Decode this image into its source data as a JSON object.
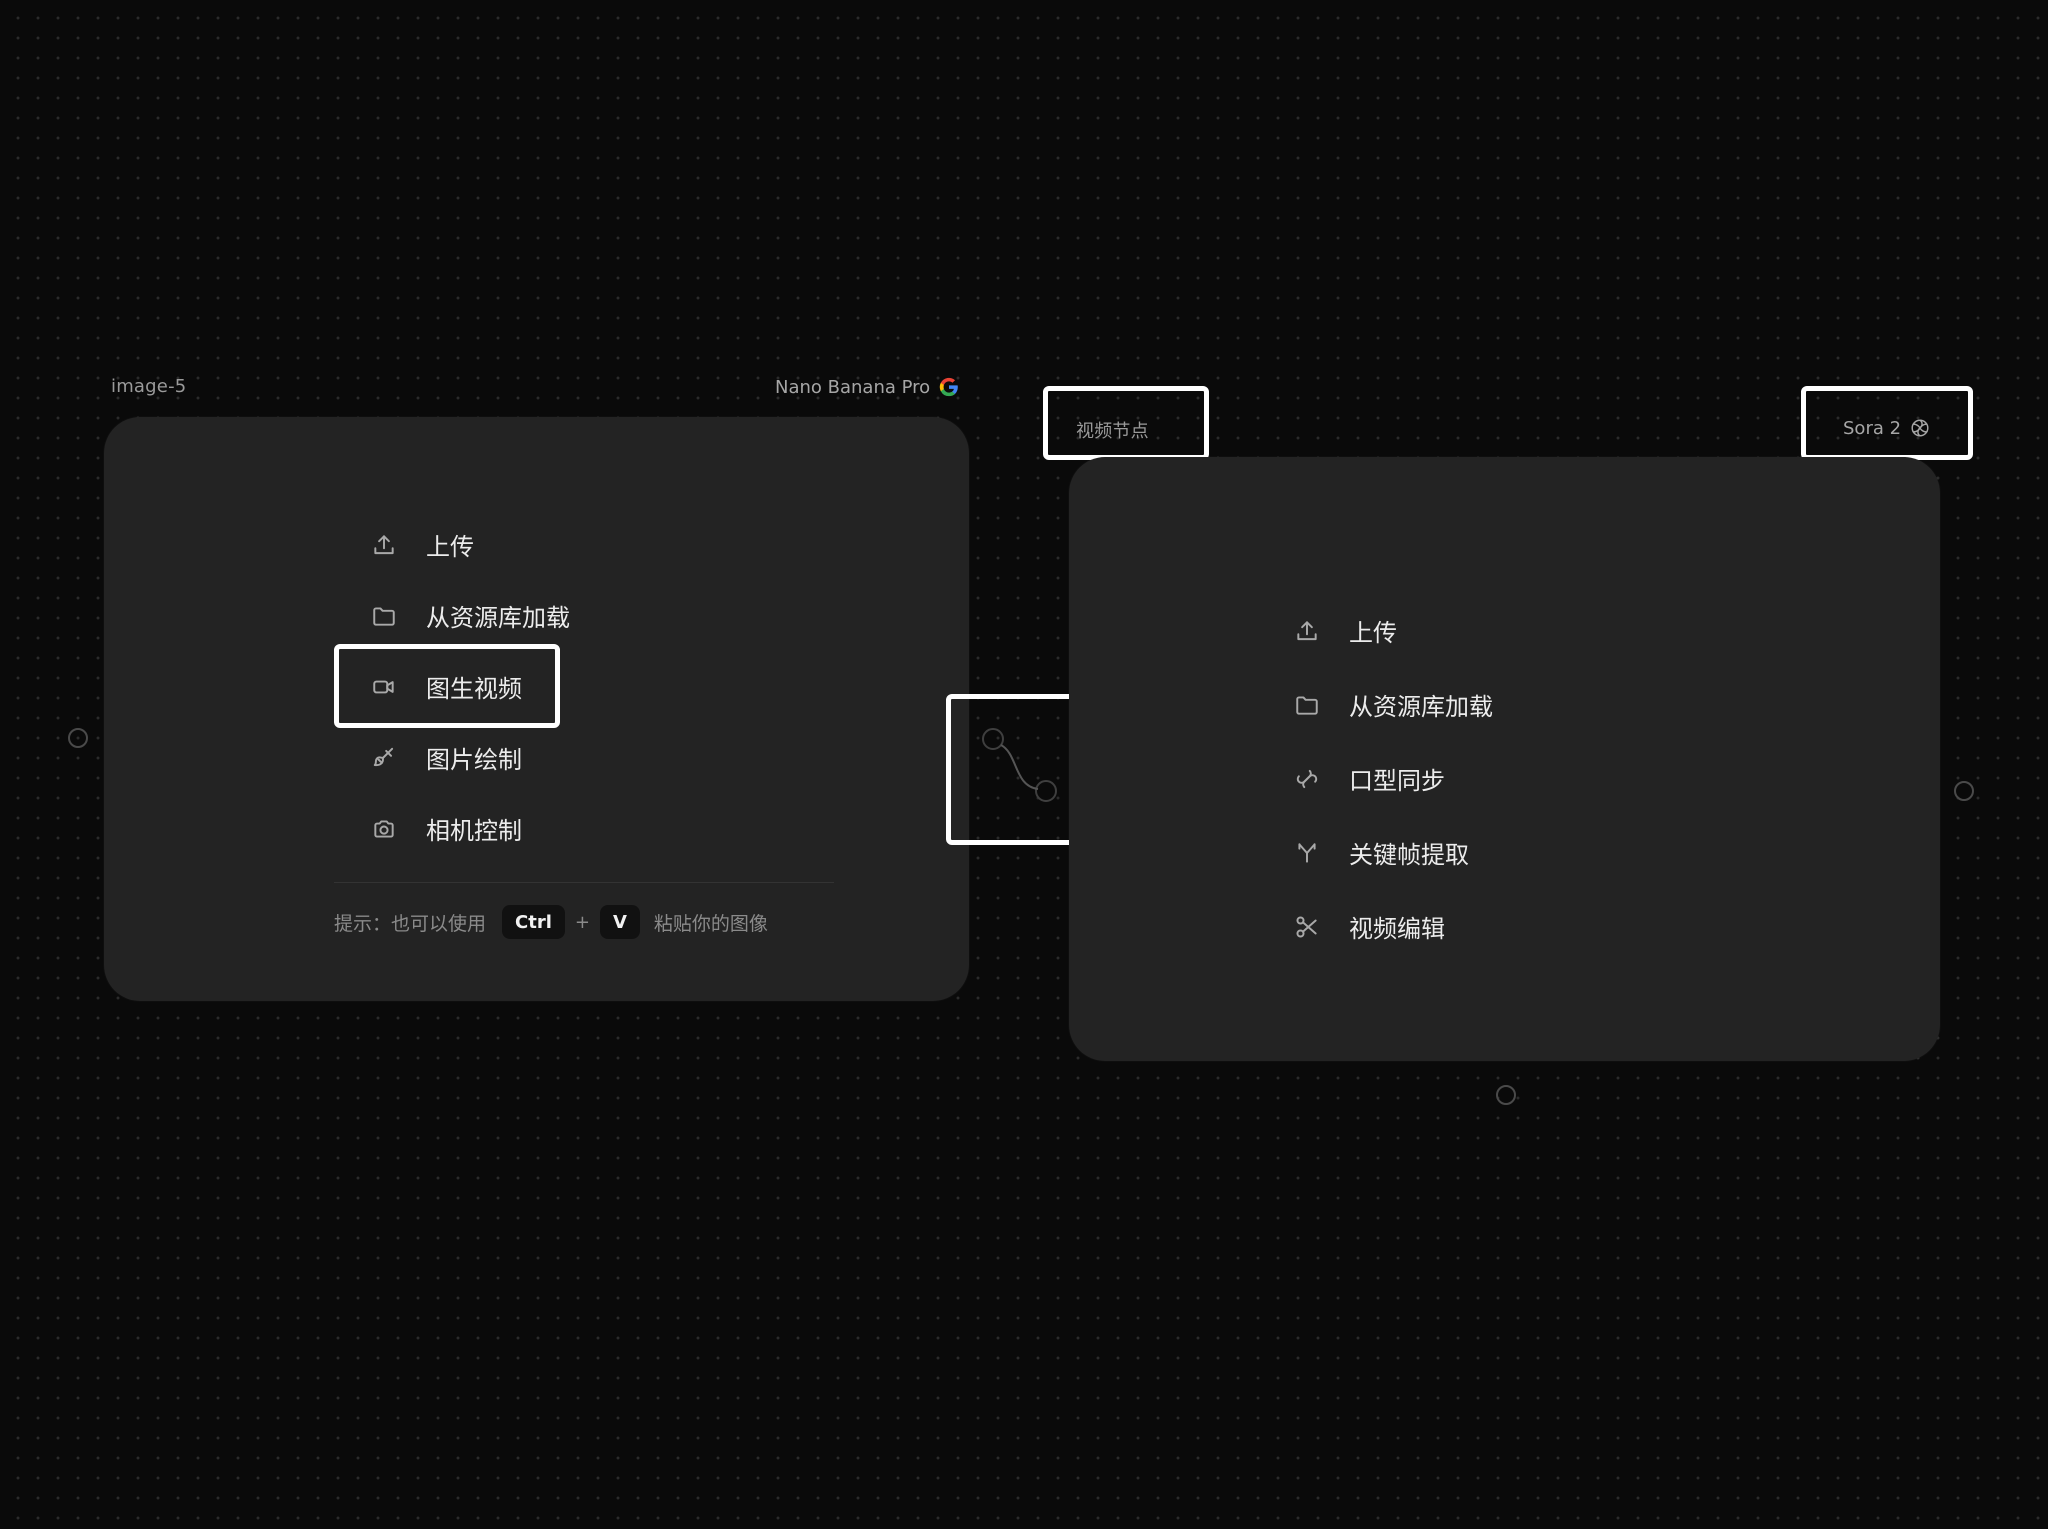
{
  "left_node": {
    "name": "image-5",
    "model": "Nano Banana Pro",
    "model_icon": "google-g-icon",
    "menu": [
      {
        "label": "上传",
        "icon": "upload-icon"
      },
      {
        "label": "从资源库加载",
        "icon": "folder-icon"
      },
      {
        "label": "图生视频",
        "icon": "video-camera-icon"
      },
      {
        "label": "图片绘制",
        "icon": "brush-icon"
      },
      {
        "label": "相机控制",
        "icon": "camera-icon"
      }
    ],
    "hint": {
      "prefix": "提示：也可以使用",
      "key1": "Ctrl",
      "plus": "+",
      "key2": "V",
      "suffix": "粘贴你的图像"
    }
  },
  "right_node": {
    "name": "视频节点",
    "model": "Sora 2",
    "model_icon": "openai-icon",
    "menu": [
      {
        "label": "上传",
        "icon": "upload-icon"
      },
      {
        "label": "从资源库加载",
        "icon": "folder-icon"
      },
      {
        "label": "口型同步",
        "icon": "lip-sync-icon"
      },
      {
        "label": "关键帧提取",
        "icon": "keyframe-icon"
      },
      {
        "label": "视频编辑",
        "icon": "scissors-icon"
      }
    ]
  },
  "colors": {
    "background": "#0a0a0a",
    "card": "#232323",
    "highlight": "#ffffff"
  }
}
